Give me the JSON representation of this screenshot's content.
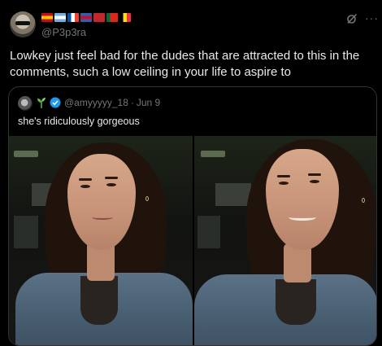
{
  "author": {
    "handle": "@P3p3ra",
    "flags": [
      {
        "name": "spain-flag-icon",
        "colors": [
          "#c60b1e",
          "#ffc400",
          "#c60b1e"
        ],
        "dir": "h"
      },
      {
        "name": "argentina-flag-icon",
        "colors": [
          "#74acdf",
          "#ffffff",
          "#74acdf"
        ],
        "dir": "h"
      },
      {
        "name": "france-flag-icon",
        "colors": [
          "#0055a4",
          "#ffffff",
          "#ef4135"
        ],
        "dir": "v"
      },
      {
        "name": "flag-icon-4",
        "colors": [
          "#2f5fae",
          "#c8102e",
          "#2f5fae"
        ],
        "dir": "h"
      },
      {
        "name": "morocco-flag-icon",
        "colors": [
          "#c1272d",
          "#c1272d",
          "#c1272d"
        ],
        "dir": "h"
      },
      {
        "name": "portugal-flag-icon",
        "colors": [
          "#046a38",
          "#da291c",
          "#da291c"
        ],
        "dir": "v"
      },
      {
        "name": "belgium-flag-icon",
        "colors": [
          "#000000",
          "#fdda24",
          "#ef3340"
        ],
        "dir": "v"
      }
    ]
  },
  "post": {
    "text": "Lowkey just feel bad for the dudes that are attracted to this in the comments, such a low ceiling in your life to aspire to"
  },
  "quoted": {
    "handle": "@amyyyyy_18",
    "separator": "·",
    "date": "Jun 9",
    "text": "she's ridiculously gorgeous"
  },
  "colors": {
    "background": "#000000",
    "text": "#e7e9ea",
    "muted": "#71767b",
    "border": "#2f3336",
    "verified": "#1d9bf0"
  }
}
